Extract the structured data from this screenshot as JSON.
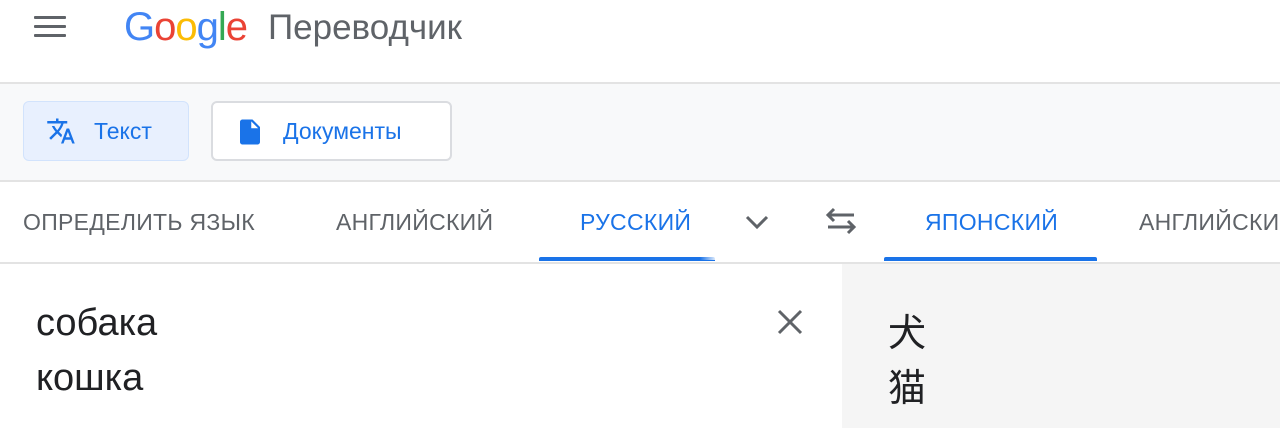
{
  "header": {
    "logo_letters": [
      "G",
      "o",
      "o",
      "g",
      "l",
      "e"
    ],
    "product_name": "Переводчик",
    "menu_icon": "hamburger-menu-icon"
  },
  "modes": {
    "text_label": "Текст",
    "docs_label": "Документы",
    "text_icon": "translate-icon",
    "docs_icon": "document-icon"
  },
  "source_langs": {
    "detect": "ОПРЕДЕЛИТЬ ЯЗЫК",
    "english": "АНГЛИЙСКИЙ",
    "russian": "РУССКИЙ",
    "active": "РУССКИЙ"
  },
  "target_langs": {
    "japanese": "ЯПОНСКИЙ",
    "english": "АНГЛИЙСКИ",
    "active": "ЯПОНСКИЙ"
  },
  "source_text": [
    "собака",
    "кошка"
  ],
  "translation": [
    "犬",
    "猫"
  ],
  "colors": {
    "accent": "#1a73e8",
    "active_tab_bg": "#e8f0fe",
    "muted_text": "#5f6368",
    "result_panel_bg": "#f5f5f5"
  }
}
